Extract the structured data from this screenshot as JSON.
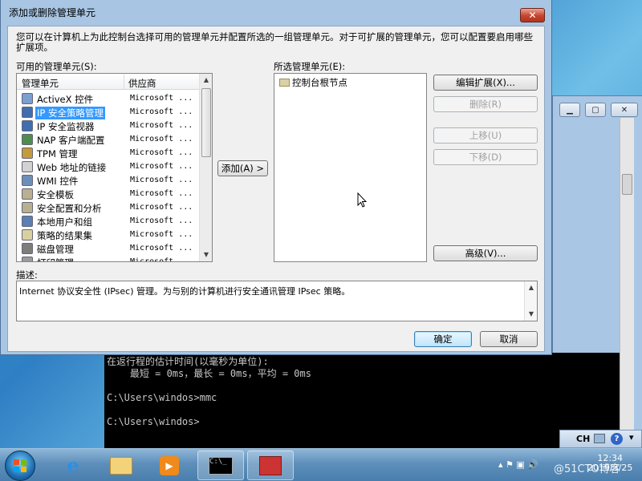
{
  "dialog": {
    "title": "添加或删除管理单元",
    "close_label": "✕",
    "intro": "您可以在计算机上为此控制台选择可用的管理单元并配置所选的一组管理单元。对于可扩展的管理单元，您可以配置要启用哪些扩展项。",
    "available_label": "可用的管理单元(S):",
    "selected_label": "所选管理单元(E):",
    "columns": {
      "name": "管理单元",
      "vendor": "供应商"
    },
    "snapins": [
      {
        "name": "ActiveX 控件",
        "vendor": "Microsoft ...",
        "icon": "activex-icon",
        "color": "#7a9fd1"
      },
      {
        "name": "IP 安全策略管理",
        "vendor": "Microsoft ...",
        "icon": "ip-security-policy-icon",
        "color": "#3f6fb0",
        "selected": true
      },
      {
        "name": "IP 安全监视器",
        "vendor": "Microsoft ...",
        "icon": "ip-security-monitor-icon",
        "color": "#3f6fb0"
      },
      {
        "name": "NAP 客户端配置",
        "vendor": "Microsoft ...",
        "icon": "nap-client-icon",
        "color": "#4f8d4f"
      },
      {
        "name": "TPM 管理",
        "vendor": "Microsoft ...",
        "icon": "tpm-icon",
        "color": "#c59a3b"
      },
      {
        "name": "Web 地址的链接",
        "vendor": "Microsoft ...",
        "icon": "web-link-icon",
        "color": "#d2d2d2"
      },
      {
        "name": "WMI 控件",
        "vendor": "Microsoft ...",
        "icon": "wmi-icon",
        "color": "#6c8fb8"
      },
      {
        "name": "安全模板",
        "vendor": "Microsoft ...",
        "icon": "security-template-icon",
        "color": "#b8b090"
      },
      {
        "name": "安全配置和分析",
        "vendor": "Microsoft ...",
        "icon": "security-analysis-icon",
        "color": "#b8b090"
      },
      {
        "name": "本地用户和组",
        "vendor": "Microsoft ...",
        "icon": "local-users-icon",
        "color": "#5a7fb3"
      },
      {
        "name": "策略的结果集",
        "vendor": "Microsoft ...",
        "icon": "rsop-icon",
        "color": "#d8d0a0"
      },
      {
        "name": "磁盘管理",
        "vendor": "Microsoft ...",
        "icon": "disk-management-icon",
        "color": "#7d7d7d"
      },
      {
        "name": "打印管理",
        "vendor": "Microsoft ...",
        "icon": "print-management-icon",
        "color": "#9a9a9a"
      }
    ],
    "add_button": "添加(A) >",
    "selected_root": "控制台根节点",
    "buttons": {
      "edit_extensions": "编辑扩展(X)...",
      "remove": "删除(R)",
      "move_up": "上移(U)",
      "move_down": "下移(D)",
      "advanced": "高级(V)..."
    },
    "description_label": "描述:",
    "description": "Internet 协议安全性 (IPsec) 管理。为与别的计算机进行安全通讯管理 IPsec 策略。",
    "ok": "确定",
    "cancel": "取消"
  },
  "console": {
    "lines": [
      "在返行程的估计时间(以毫秒为单位):",
      "    最短 = 0ms，最长 = 0ms，平均 = 0ms",
      "",
      "C:\\Users\\windos>mmc",
      "",
      "C:\\Users\\windos>"
    ]
  },
  "taskbar": {
    "language": "CH",
    "clock_time": "12:34",
    "clock_date": "2019/3/25",
    "watermark": "@51CTO博客"
  }
}
